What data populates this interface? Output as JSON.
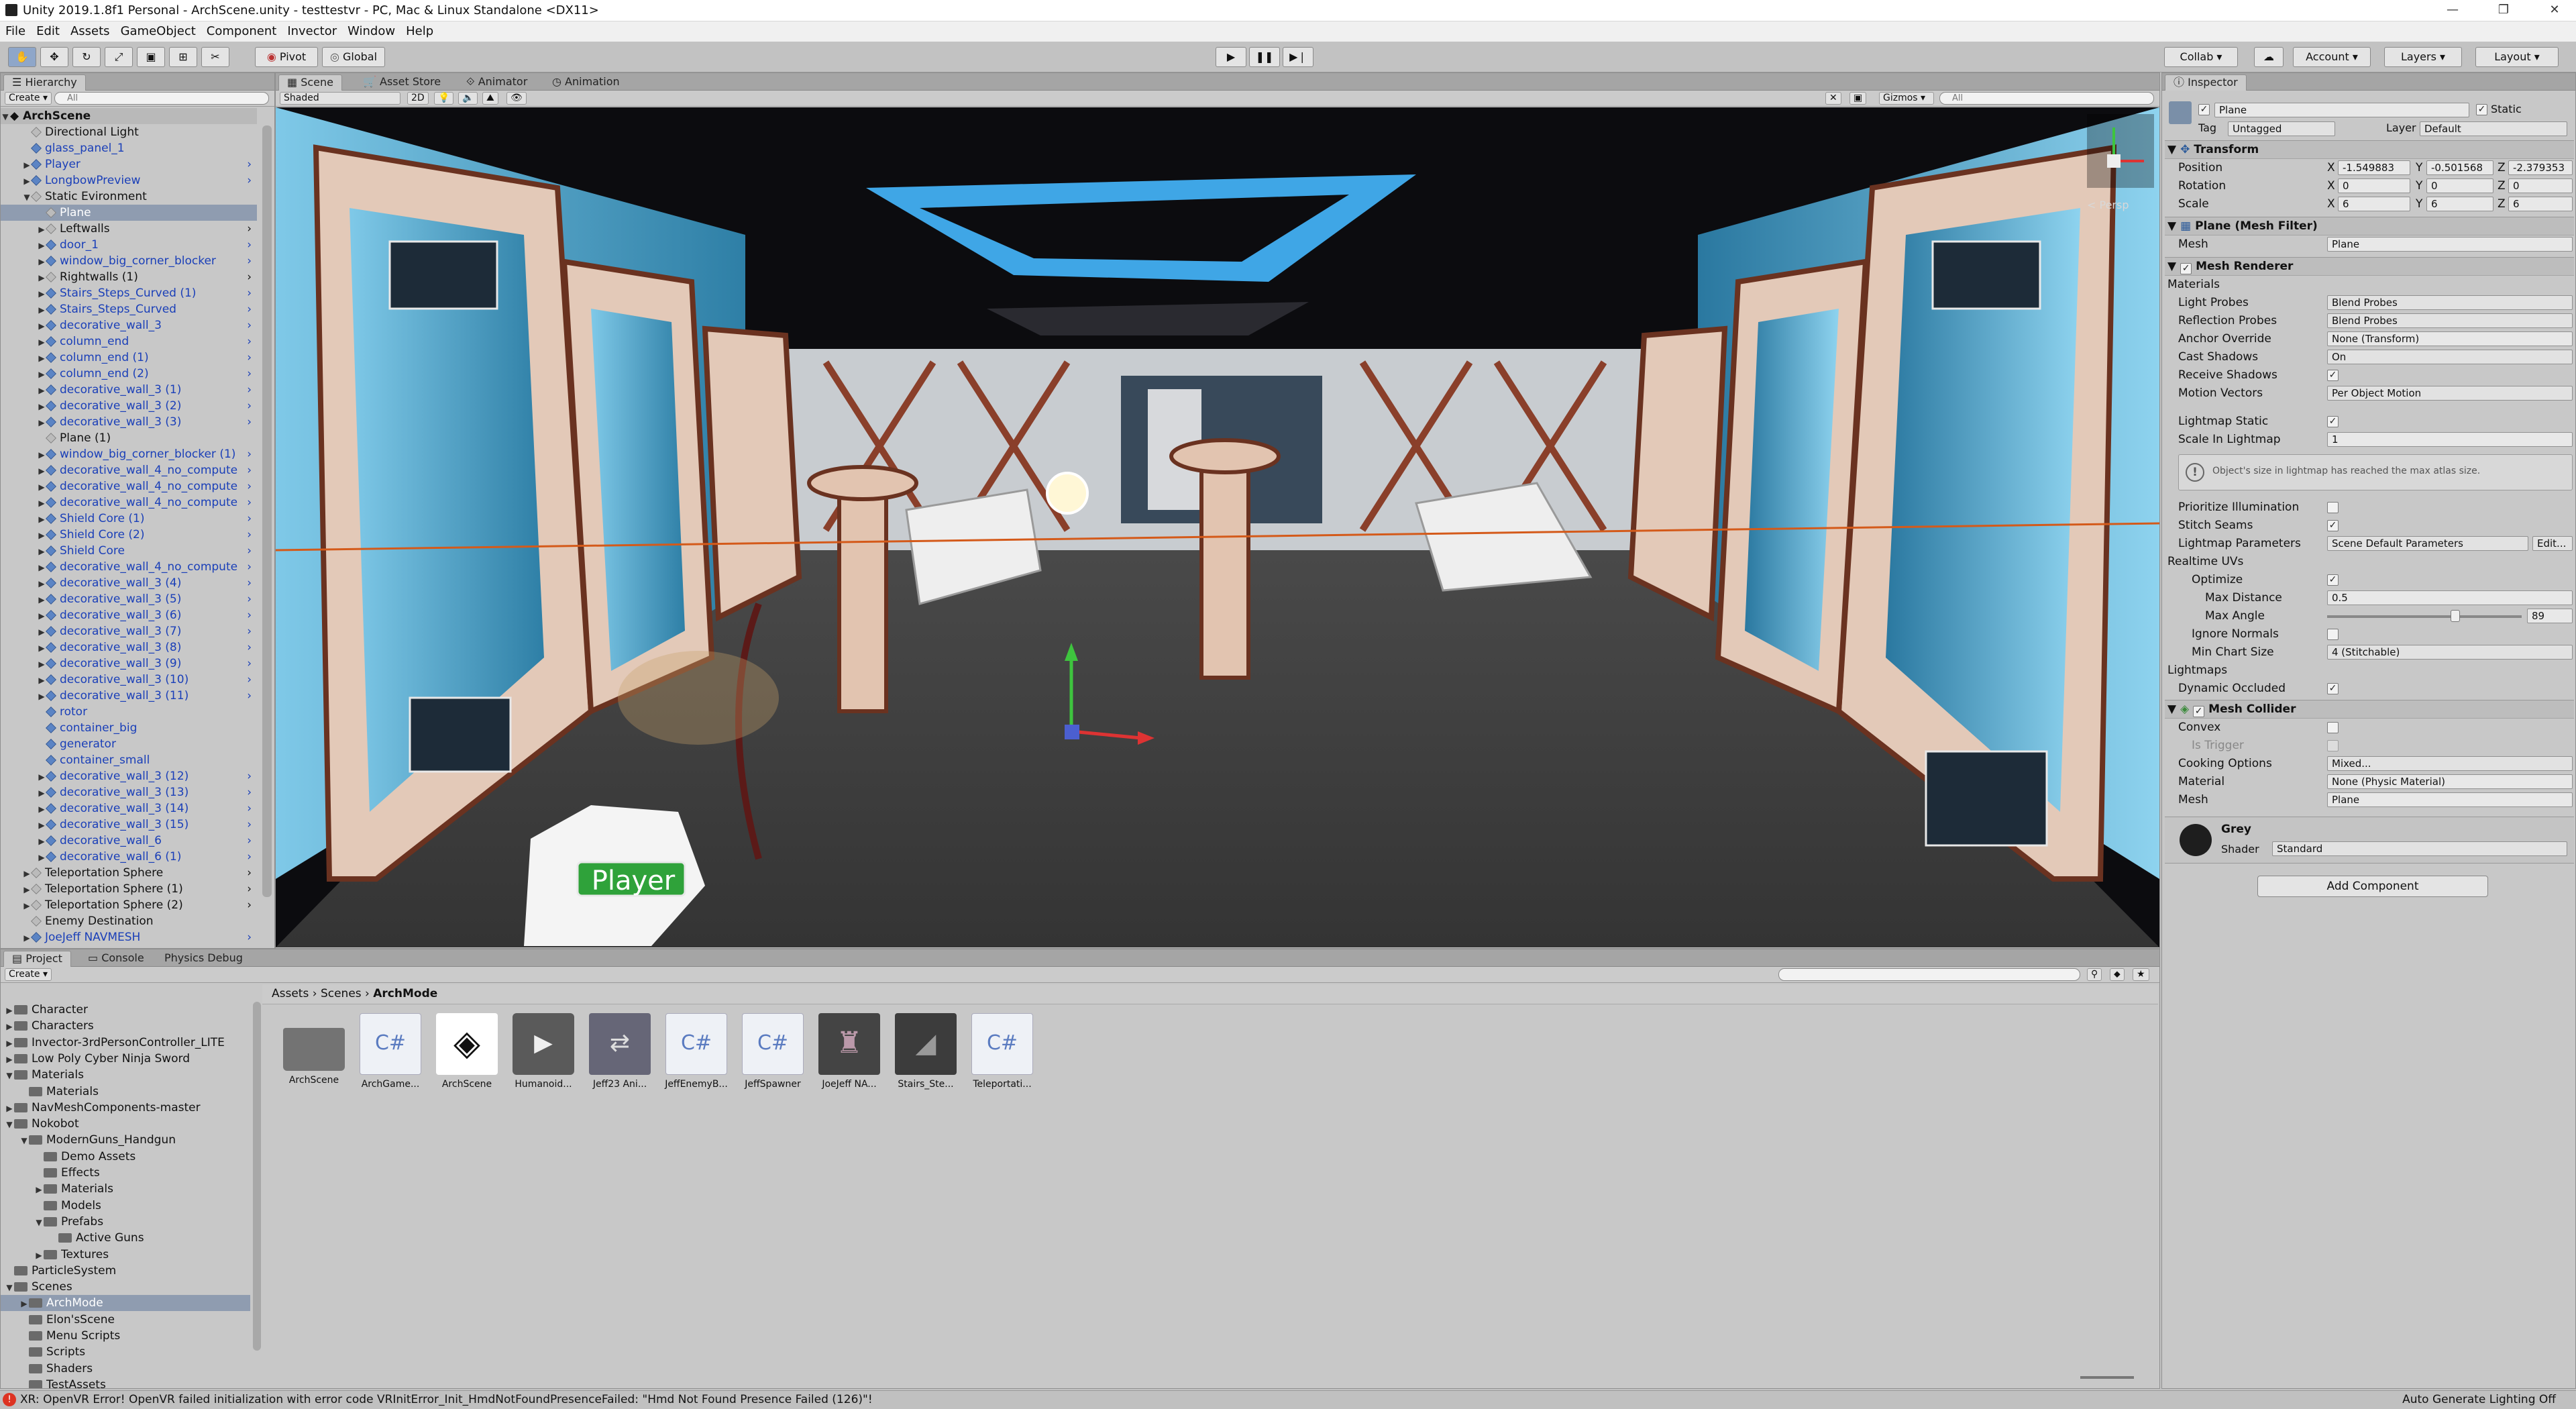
{
  "window": {
    "title": "Unity 2019.1.8f1 Personal - ArchScene.unity - testtestvr - PC, Mac & Linux Standalone <DX11>",
    "minimize": "—",
    "maximize": "❐",
    "close": "✕"
  },
  "menu": [
    "File",
    "Edit",
    "Assets",
    "GameObject",
    "Component",
    "Invector",
    "Window",
    "Help"
  ],
  "toolbar": {
    "pivot": "Pivot",
    "global": "Global",
    "collab": "Collab ▾",
    "account": "Account ▾",
    "layers": "Layers ▾",
    "layout": "Layout ▾"
  },
  "hierarchy": {
    "tab": "Hierarchy",
    "create": "Create ▾",
    "search": "All",
    "scene": "ArchScene",
    "items": [
      {
        "label": "Directional Light",
        "indent": 1,
        "arrow": "",
        "blue": false,
        "sel": false
      },
      {
        "label": "glass_panel_1",
        "indent": 1,
        "arrow": "",
        "blue": true,
        "sel": false
      },
      {
        "label": "Player",
        "indent": 1,
        "arrow": "▶",
        "blue": true,
        "sel": false
      },
      {
        "label": "LongbowPreview",
        "indent": 1,
        "arrow": "▶",
        "blue": true,
        "sel": false
      },
      {
        "label": "Static Evironment",
        "indent": 1,
        "arrow": "▼",
        "blue": false,
        "sel": false
      },
      {
        "label": "Plane",
        "indent": 2,
        "arrow": "",
        "blue": false,
        "sel": true
      },
      {
        "label": "Leftwalls",
        "indent": 2,
        "arrow": "▶",
        "blue": false,
        "sel": false
      },
      {
        "label": "door_1",
        "indent": 2,
        "arrow": "▶",
        "blue": true,
        "sel": false
      },
      {
        "label": "window_big_corner_blocker",
        "indent": 2,
        "arrow": "▶",
        "blue": true,
        "sel": false
      },
      {
        "label": "Rightwalls (1)",
        "indent": 2,
        "arrow": "▶",
        "blue": false,
        "sel": false
      },
      {
        "label": "Stairs_Steps_Curved (1)",
        "indent": 2,
        "arrow": "▶",
        "blue": true,
        "sel": false
      },
      {
        "label": "Stairs_Steps_Curved",
        "indent": 2,
        "arrow": "▶",
        "blue": true,
        "sel": false
      },
      {
        "label": "decorative_wall_3",
        "indent": 2,
        "arrow": "▶",
        "blue": true,
        "sel": false
      },
      {
        "label": "column_end",
        "indent": 2,
        "arrow": "▶",
        "blue": true,
        "sel": false
      },
      {
        "label": "column_end (1)",
        "indent": 2,
        "arrow": "▶",
        "blue": true,
        "sel": false
      },
      {
        "label": "column_end (2)",
        "indent": 2,
        "arrow": "▶",
        "blue": true,
        "sel": false
      },
      {
        "label": "decorative_wall_3 (1)",
        "indent": 2,
        "arrow": "▶",
        "blue": true,
        "sel": false
      },
      {
        "label": "decorative_wall_3 (2)",
        "indent": 2,
        "arrow": "▶",
        "blue": true,
        "sel": false
      },
      {
        "label": "decorative_wall_3 (3)",
        "indent": 2,
        "arrow": "▶",
        "blue": true,
        "sel": false
      },
      {
        "label": "Plane (1)",
        "indent": 2,
        "arrow": "",
        "blue": false,
        "sel": false
      },
      {
        "label": "window_big_corner_blocker (1)",
        "indent": 2,
        "arrow": "▶",
        "blue": true,
        "sel": false
      },
      {
        "label": "decorative_wall_4_no_compute",
        "indent": 2,
        "arrow": "▶",
        "blue": true,
        "sel": false
      },
      {
        "label": "decorative_wall_4_no_compute",
        "indent": 2,
        "arrow": "▶",
        "blue": true,
        "sel": false
      },
      {
        "label": "decorative_wall_4_no_compute",
        "indent": 2,
        "arrow": "▶",
        "blue": true,
        "sel": false
      },
      {
        "label": "Shield Core (1)",
        "indent": 2,
        "arrow": "▶",
        "blue": true,
        "sel": false
      },
      {
        "label": "Shield Core (2)",
        "indent": 2,
        "arrow": "▶",
        "blue": true,
        "sel": false
      },
      {
        "label": "Shield Core",
        "indent": 2,
        "arrow": "▶",
        "blue": true,
        "sel": false
      },
      {
        "label": "decorative_wall_4_no_compute",
        "indent": 2,
        "arrow": "▶",
        "blue": true,
        "sel": false
      },
      {
        "label": "decorative_wall_3 (4)",
        "indent": 2,
        "arrow": "▶",
        "blue": true,
        "sel": false
      },
      {
        "label": "decorative_wall_3 (5)",
        "indent": 2,
        "arrow": "▶",
        "blue": true,
        "sel": false
      },
      {
        "label": "decorative_wall_3 (6)",
        "indent": 2,
        "arrow": "▶",
        "blue": true,
        "sel": false
      },
      {
        "label": "decorative_wall_3 (7)",
        "indent": 2,
        "arrow": "▶",
        "blue": true,
        "sel": false
      },
      {
        "label": "decorative_wall_3 (8)",
        "indent": 2,
        "arrow": "▶",
        "blue": true,
        "sel": false
      },
      {
        "label": "decorative_wall_3 (9)",
        "indent": 2,
        "arrow": "▶",
        "blue": true,
        "sel": false
      },
      {
        "label": "decorative_wall_3 (10)",
        "indent": 2,
        "arrow": "▶",
        "blue": true,
        "sel": false
      },
      {
        "label": "decorative_wall_3 (11)",
        "indent": 2,
        "arrow": "▶",
        "blue": true,
        "sel": false
      },
      {
        "label": "rotor",
        "indent": 2,
        "arrow": "",
        "blue": true,
        "sel": false
      },
      {
        "label": "container_big",
        "indent": 2,
        "arrow": "",
        "blue": true,
        "sel": false
      },
      {
        "label": "generator",
        "indent": 2,
        "arrow": "",
        "blue": true,
        "sel": false
      },
      {
        "label": "container_small",
        "indent": 2,
        "arrow": "",
        "blue": true,
        "sel": false
      },
      {
        "label": "decorative_wall_3 (12)",
        "indent": 2,
        "arrow": "▶",
        "blue": true,
        "sel": false
      },
      {
        "label": "decorative_wall_3 (13)",
        "indent": 2,
        "arrow": "▶",
        "blue": true,
        "sel": false
      },
      {
        "label": "decorative_wall_3 (14)",
        "indent": 2,
        "arrow": "▶",
        "blue": true,
        "sel": false
      },
      {
        "label": "decorative_wall_3 (15)",
        "indent": 2,
        "arrow": "▶",
        "blue": true,
        "sel": false
      },
      {
        "label": "decorative_wall_6",
        "indent": 2,
        "arrow": "▶",
        "blue": true,
        "sel": false
      },
      {
        "label": "decorative_wall_6 (1)",
        "indent": 2,
        "arrow": "▶",
        "blue": true,
        "sel": false
      },
      {
        "label": "Teleportation Sphere",
        "indent": 1,
        "arrow": "▶",
        "blue": false,
        "sel": false
      },
      {
        "label": "Teleportation Sphere (1)",
        "indent": 1,
        "arrow": "▶",
        "blue": false,
        "sel": false
      },
      {
        "label": "Teleportation Sphere (2)",
        "indent": 1,
        "arrow": "▶",
        "blue": false,
        "sel": false
      },
      {
        "label": "Enemy Destination",
        "indent": 1,
        "arrow": "",
        "blue": false,
        "sel": false
      },
      {
        "label": "JoeJeff NAVMESH",
        "indent": 1,
        "arrow": "▶",
        "blue": true,
        "sel": false
      }
    ]
  },
  "scene_tabs": {
    "scene": "Scene",
    "asset_store": "Asset Store",
    "animator": "Animator",
    "animation": "Animation",
    "shaded": "Shaded",
    "twod": "2D",
    "gizmos": "Gizmos ▾",
    "search": "All",
    "persp": "< Persp",
    "player_label": "Player"
  },
  "bottom_tabs": {
    "project": "Project",
    "console": "Console",
    "physics": "Physics Debug",
    "create": "Create ▾"
  },
  "project_tree": [
    {
      "label": "Character",
      "indent": 1,
      "arrow": "▶",
      "sel": false
    },
    {
      "label": "Characters",
      "indent": 1,
      "arrow": "▶",
      "sel": false
    },
    {
      "label": "Invector-3rdPersonController_LITE",
      "indent": 1,
      "arrow": "▶",
      "sel": false
    },
    {
      "label": "Low Poly Cyber Ninja Sword",
      "indent": 1,
      "arrow": "▶",
      "sel": false
    },
    {
      "label": "Materials",
      "indent": 1,
      "arrow": "▼",
      "sel": false
    },
    {
      "label": "Materials",
      "indent": 2,
      "arrow": "",
      "sel": false
    },
    {
      "label": "NavMeshComponents-master",
      "indent": 1,
      "arrow": "▶",
      "sel": false
    },
    {
      "label": "Nokobot",
      "indent": 1,
      "arrow": "▼",
      "sel": false
    },
    {
      "label": "ModernGuns_Handgun",
      "indent": 2,
      "arrow": "▼",
      "sel": false
    },
    {
      "label": "Demo Assets",
      "indent": 3,
      "arrow": "",
      "sel": false
    },
    {
      "label": "Effects",
      "indent": 3,
      "arrow": "",
      "sel": false
    },
    {
      "label": "Materials",
      "indent": 3,
      "arrow": "▶",
      "sel": false
    },
    {
      "label": "Models",
      "indent": 3,
      "arrow": "",
      "sel": false
    },
    {
      "label": "Prefabs",
      "indent": 3,
      "arrow": "▼",
      "sel": false
    },
    {
      "label": "Active Guns",
      "indent": 4,
      "arrow": "",
      "sel": false
    },
    {
      "label": "Textures",
      "indent": 3,
      "arrow": "▶",
      "sel": false
    },
    {
      "label": "ParticleSystem",
      "indent": 1,
      "arrow": "",
      "sel": false
    },
    {
      "label": "Scenes",
      "indent": 1,
      "arrow": "▼",
      "sel": false
    },
    {
      "label": "ArchMode",
      "indent": 2,
      "arrow": "▶",
      "sel": true
    },
    {
      "label": "Elon'sScene",
      "indent": 2,
      "arrow": "",
      "sel": false
    },
    {
      "label": "Menu Scripts",
      "indent": 2,
      "arrow": "",
      "sel": false
    },
    {
      "label": "Scripts",
      "indent": 2,
      "arrow": "",
      "sel": false
    },
    {
      "label": "Shaders",
      "indent": 2,
      "arrow": "",
      "sel": false
    },
    {
      "label": "TestAssets",
      "indent": 2,
      "arrow": "",
      "sel": false
    },
    {
      "label": "TestScene",
      "indent": 2,
      "arrow": "",
      "sel": false
    }
  ],
  "breadcrumb": {
    "a": "Assets",
    "sep1": "›",
    "b": "Scenes",
    "sep2": "›",
    "c": "ArchMode"
  },
  "assets": [
    {
      "label": "ArchScene",
      "kind": "folder"
    },
    {
      "label": "ArchGame...",
      "kind": "cs"
    },
    {
      "label": "ArchScene",
      "kind": "unity"
    },
    {
      "label": "Humanoid...",
      "kind": "anim"
    },
    {
      "label": "Jeff23 Ani...",
      "kind": "animator"
    },
    {
      "label": "JeffEnemyB...",
      "kind": "cs"
    },
    {
      "label": "JeffSpawner",
      "kind": "cs"
    },
    {
      "label": "JoeJeff NA...",
      "kind": "navmesh"
    },
    {
      "label": "Stairs_Ste...",
      "kind": "mesh"
    },
    {
      "label": "Teleportati...",
      "kind": "cs"
    }
  ],
  "inspector": {
    "tab": "Inspector",
    "name": "Plane",
    "static": "Static",
    "tag_label": "Tag",
    "tag": "Untagged",
    "layer_label": "Layer",
    "layer": "Default",
    "transform": {
      "title": "Transform",
      "position": "Position",
      "rotation": "Rotation",
      "scale": "Scale",
      "pos": [
        "-1.549883",
        "-0.501568",
        "-2.379353"
      ],
      "rot": [
        "0",
        "0",
        "0"
      ],
      "scl": [
        "6",
        "6",
        "6"
      ],
      "x": "X",
      "y": "Y",
      "z": "Z"
    },
    "mesh_filter": {
      "title": "Plane (Mesh Filter)",
      "mesh_label": "Mesh",
      "mesh": "Plane"
    },
    "mesh_renderer": {
      "title": "Mesh Renderer",
      "materials": "Materials",
      "light_probes": "Light Probes",
      "light_probes_v": "Blend Probes",
      "reflection_probes": "Reflection Probes",
      "reflection_probes_v": "Blend Probes",
      "anchor": "Anchor Override",
      "anchor_v": "None (Transform)",
      "cast_shadows": "Cast Shadows",
      "cast_shadows_v": "On",
      "receive_shadows": "Receive Shadows",
      "motion_vectors": "Motion Vectors",
      "motion_vectors_v": "Per Object Motion",
      "lightmap_static": "Lightmap Static",
      "scale_in_lightmap": "Scale In Lightmap",
      "scale_in_lightmap_v": "1",
      "help": "Object's size in lightmap has reached the max atlas size.",
      "prioritize": "Prioritize Illumination",
      "stitch": "Stitch Seams",
      "lm_params": "Lightmap Parameters",
      "lm_params_v": "Scene Default Parameters",
      "edit": "Edit...",
      "realtime_uvs": "Realtime UVs",
      "optimize": "Optimize",
      "max_distance": "Max Distance",
      "max_distance_v": "0.5",
      "max_angle": "Max Angle",
      "max_angle_v": "89",
      "max_angle_frac": 0.66,
      "ignore_normals": "Ignore Normals",
      "min_chart": "Min Chart Size",
      "min_chart_v": "4 (Stitchable)",
      "lightmaps": "Lightmaps",
      "dynamic_occluded": "Dynamic Occluded"
    },
    "mesh_collider": {
      "title": "Mesh Collider",
      "convex": "Convex",
      "is_trigger": "Is Trigger",
      "cooking": "Cooking Options",
      "cooking_v": "Mixed...",
      "material": "Material",
      "material_v": "None (Physic Material)",
      "mesh": "Mesh",
      "mesh_v": "Plane"
    },
    "material": {
      "name": "Grey",
      "shader_label": "Shader",
      "shader": "Standard"
    },
    "add_component": "Add Component"
  },
  "status": {
    "error": "XR: OpenVR Error! OpenVR failed initialization with error code VRInitError_Init_HmdNotFoundPresenceFailed: \"Hmd Not Found Presence Failed (126)\"!",
    "right": "Auto Generate Lighting Off"
  }
}
